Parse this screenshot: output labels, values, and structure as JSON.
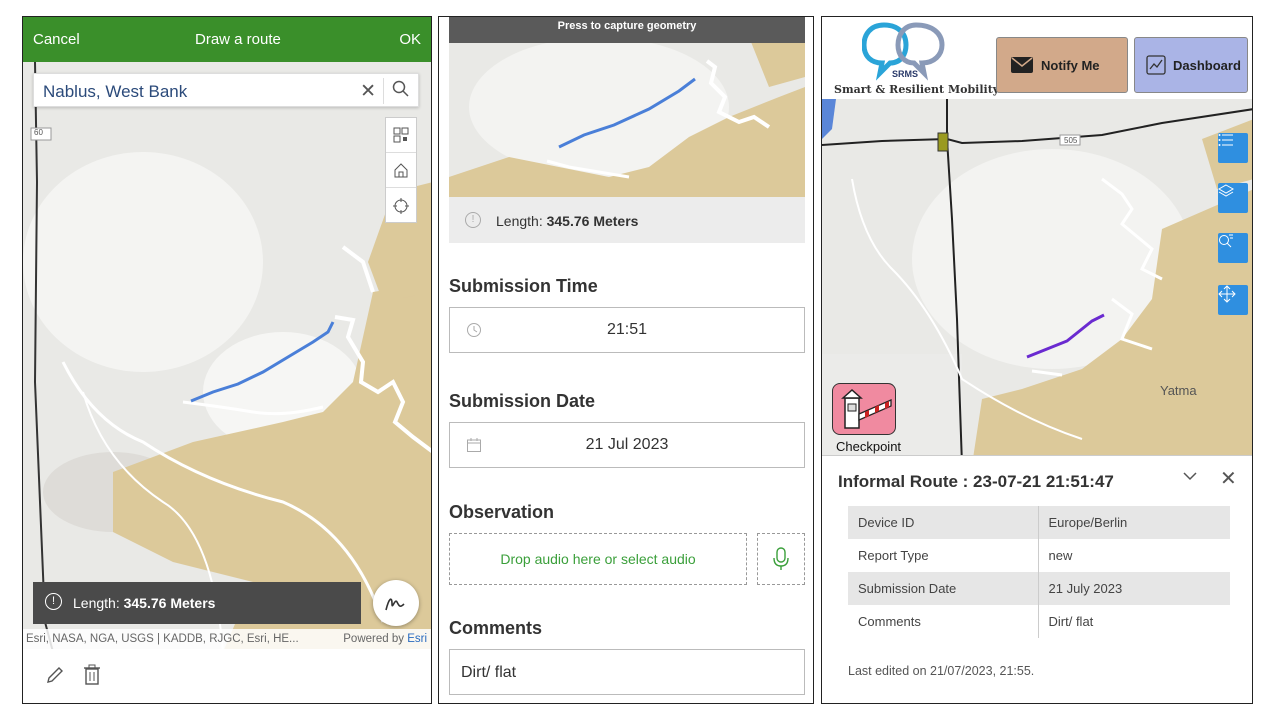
{
  "draw": {
    "cancel": "Cancel",
    "title": "Draw a route",
    "ok": "OK",
    "search_value": "Nablus, West Bank",
    "road_label": "60",
    "length_label": "Length:",
    "length_value": "345.76 Meters",
    "attribution": "Esri, NASA, NGA, USGS | KADDB, RJGC, Esri, HE...",
    "powered_by": "Powered by",
    "powered_brand": "Esri"
  },
  "form": {
    "capture_banner": "Press to capture geometry",
    "length_label": "Length:",
    "length_value": "345.76 Meters",
    "submission_time_label": "Submission Time",
    "submission_time_value": "21:51",
    "submission_date_label": "Submission Date",
    "submission_date_value": "21 Jul 2023",
    "observation_label": "Observation",
    "audio_placeholder": "Drop audio here or select audio",
    "comments_label": "Comments",
    "comments_value": "Dirt/ flat"
  },
  "srms": {
    "logo": "SRMS",
    "tagline": "Smart & Resilient Mobility",
    "notify_label": "Notify Me",
    "dashboard_label": "Dashboard",
    "road_label": "505",
    "place_label": "Yatma",
    "checkpoint_label": "Checkpoint",
    "popup_title": "Informal Route : 23-07-21 21:51:47",
    "rows": [
      {
        "key": "Device ID",
        "value": "Europe/Berlin"
      },
      {
        "key": "Report Type",
        "value": "new"
      },
      {
        "key": "Submission Date",
        "value": "21 July 2023"
      },
      {
        "key": "Comments",
        "value": "Dirt/ flat"
      }
    ],
    "last_edited": "Last edited on 21/07/2023, 21:55."
  },
  "colors": {
    "topbar_green": "#3a8f2a",
    "route_blue": "#4a7fd8",
    "route_purple": "#6a2ad0",
    "map_urban": "#dcc99a",
    "control_blue": "#2f8fe0",
    "notify_bg": "#d2a98a",
    "dashboard_bg": "#aab4e6",
    "checkpoint_bg": "#f08aa0"
  }
}
